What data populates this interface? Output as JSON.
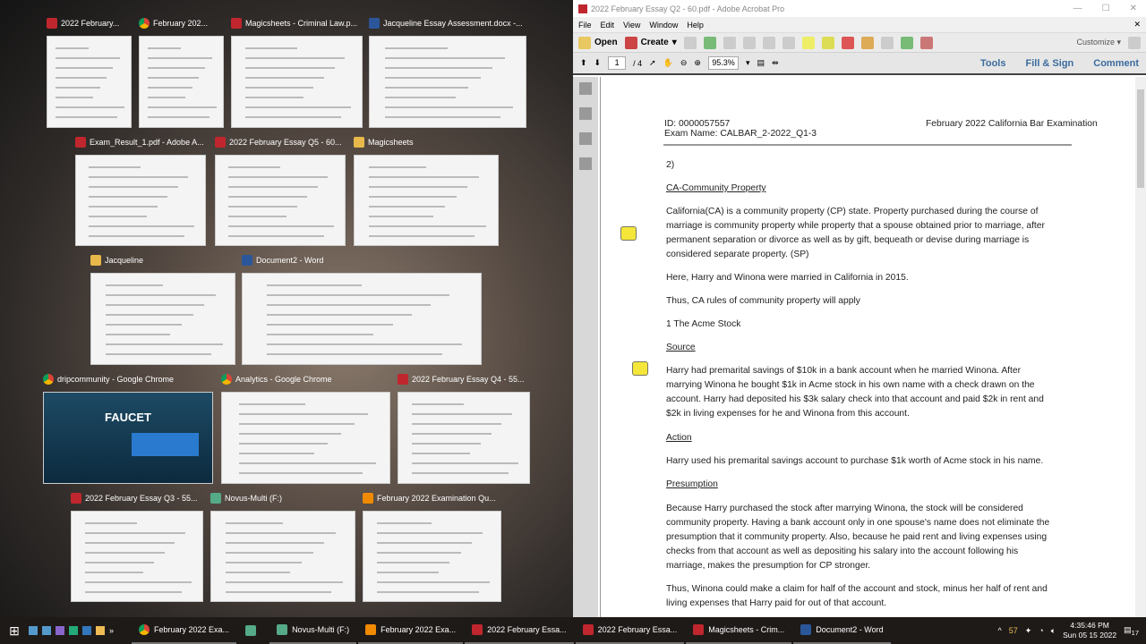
{
  "switcher": {
    "windows": [
      {
        "title": "2022 February...",
        "app": "pdf"
      },
      {
        "title": "February 202...",
        "app": "chrome"
      },
      {
        "title": "Magicsheets - Criminal Law.p...",
        "app": "pdf"
      },
      {
        "title": "Jacqueline Essay Assessment.docx -...",
        "app": "word"
      },
      {
        "title": "Exam_Result_1.pdf - Adobe A...",
        "app": "pdf"
      },
      {
        "title": "2022 February Essay Q5 - 60...",
        "app": "pdf"
      },
      {
        "title": "Magicsheets",
        "app": "folder"
      },
      {
        "title": "Jacqueline",
        "app": "folder"
      },
      {
        "title": "Document2 - Word",
        "app": "word"
      },
      {
        "title": "dripcommunity - Google Chrome",
        "app": "chrome",
        "preview_text": "FAUCET"
      },
      {
        "title": "Analytics - Google Chrome",
        "app": "chrome"
      },
      {
        "title": "2022 February Essay Q4 - 55...",
        "app": "pdf"
      },
      {
        "title": "2022 February Essay Q3 - 55...",
        "app": "pdf"
      },
      {
        "title": "Novus-Multi (F:)",
        "app": "drive"
      },
      {
        "title": "February 2022 Examination Qu...",
        "app": "vlc"
      }
    ]
  },
  "acrobat": {
    "title": "2022 February Essay Q2 - 60.pdf - Adobe Acrobat Pro",
    "menu": [
      "File",
      "Edit",
      "View",
      "Window",
      "Help"
    ],
    "toolbar": {
      "open": "Open",
      "create": "Create",
      "customize": "Customize"
    },
    "nav": {
      "page": "1",
      "page_total": "/ 4",
      "zoom": "95.3%",
      "tools": "Tools",
      "fill_sign": "Fill & Sign",
      "comment": "Comment"
    },
    "doc": {
      "id": "ID: 0000057557",
      "exam_name": "Exam Name: CALBAR_2-2022_Q1-3",
      "exam_title": "February 2022 California Bar Examination",
      "lines": [
        {
          "text": "2)"
        },
        {
          "text": "CA-Community Property",
          "u": true
        },
        {
          "text": "California(CA) is a community property (CP) state.  Property purchased during the course of"
        },
        {
          "text": "marriage is community property while property that a spouse obtained prior to marriage, after"
        },
        {
          "text": "permanent separation or divorce as well as by gift, bequeath or devise during marriage is"
        },
        {
          "text": "considered separate property. (SP)"
        },
        {
          "text": "Here, Harry and Winona were married in California in 2015."
        },
        {
          "text": "Thus, CA rules of community property will apply"
        },
        {
          "text": "1  The Acme Stock"
        },
        {
          "text": "Source",
          "u": true
        },
        {
          "text": "Harry had premarital savings of $10k in a bank account when he married Winona.  After"
        },
        {
          "text": "marrying Winona he bought $1k in Acme stock in his own name with a check drawn on the"
        },
        {
          "text": "account. Harry had deposited his $3k salary check into that account and paid $2k in rent and"
        },
        {
          "text": "$2k in living expenses for he and Winona from this account."
        },
        {
          "text": "Action",
          "u": true
        },
        {
          "text": "Harry used his premarital savings account to purchase $1k worth of Acme stock in his name."
        },
        {
          "text": "Presumption",
          "u": true
        },
        {
          "text": "Because Harry purchased the stock after marrying Winona, the stock will be considered"
        },
        {
          "text": "community property.  Having a bank account only in one spouse's name does not eliminate the"
        },
        {
          "text": "presumption that it community property.  Also, because he paid rent and living expenses using"
        },
        {
          "text": "checks from that account as well as depositing his salary into the account following his"
        },
        {
          "text": "marriage, makes the presumption for CP stronger."
        },
        {
          "text": "Thus, Winona could make a claim for half of the account and stock, minus her half of rent and"
        },
        {
          "text": "living expenses that Harry paid for out of that account."
        }
      ]
    }
  },
  "taskbar": {
    "items": [
      {
        "label": "February 2022 Exa...",
        "app": "chrome"
      },
      {
        "label": "",
        "app": "app"
      },
      {
        "label": "Novus-Multi (F:)",
        "app": "drive"
      },
      {
        "label": "February 2022 Exa...",
        "app": "vlc"
      },
      {
        "label": "2022 February Essa...",
        "app": "pdf"
      },
      {
        "label": "2022 February Essa...",
        "app": "pdf"
      },
      {
        "label": "Magicsheets - Crim...",
        "app": "pdf"
      },
      {
        "label": "Document2 - Word",
        "app": "word"
      }
    ],
    "battery_badge": "57",
    "time": "4:35:46 PM",
    "date": "Sun 05 15 2022",
    "notifications": "17"
  }
}
